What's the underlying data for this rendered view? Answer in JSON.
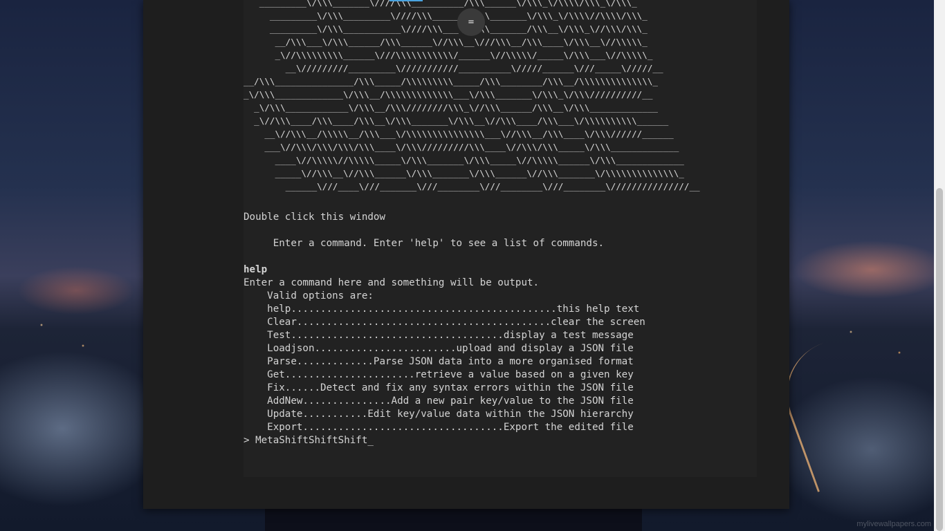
{
  "ascii_art": [
    "   _________\\/\\\\\\_______\\////\\\\\\__________/\\\\\\______\\/\\\\\\_\\/\\\\\\\\/\\\\\\_\\/\\\\\\_",
    "     _________\\/\\\\\\_________\\////\\\\\\_______/\\\\\\_______\\/\\\\\\_\\/\\\\\\\\//\\\\\\\\/\\\\\\_",
    "     _________\\/\\\\\\___________\\////\\\\\\___\\//\\\\\\_______/\\\\\\__\\/\\\\\\_\\//\\\\\\/\\\\\\_",
    "      __/\\\\\\___\\/\\\\\\______/\\\\\\______\\//\\\\\\__\\///\\\\\\__/\\\\\\____\\/\\\\\\__\\//\\\\\\\\\\_",
    "      _\\//\\\\\\\\\\\\\\\\\\______\\///\\\\\\\\\\\\\\\\\\\\\\/______\\//\\\\\\\\\\/_____\\/\\\\\\___\\//\\\\\\\\\\_",
    "        __\\/////////_________\\///////////__________\\/////______\\///_____\\/////__",
    "__/\\\\\\_______________/\\\\\\_____/\\\\\\\\\\\\\\\\\\_____/\\\\\\________/\\\\\\__/\\\\\\\\\\\\\\\\\\\\\\\\\\\\_",
    "_\\/\\\\\\_____________\\/\\\\\\__/\\\\\\\\\\\\\\\\\\\\\\\\\\___\\/\\\\\\_______\\/\\\\\\_\\/\\\\\\//////////__",
    "  _\\/\\\\\\____________\\/\\\\\\__/\\\\\\////////\\\\\\_\\//\\\\\\______/\\\\\\__\\/\\\\\\_____________",
    "  _\\//\\\\\\____/\\\\\\____/\\\\\\__\\/\\\\\\_______\\/\\\\\\__\\//\\\\\\____/\\\\\\___\\/\\\\\\\\\\\\\\\\\\\\______",
    "    __\\//\\\\\\__/\\\\\\\\\\__/\\\\\\___\\/\\\\\\\\\\\\\\\\\\\\\\\\\\\\\\___\\//\\\\\\__/\\\\\\____\\/\\\\\\//////______",
    "    ___\\//\\\\\\/\\\\\\/\\\\\\/\\\\\\____\\/\\\\\\/////////\\\\\\____\\//\\\\\\/\\\\\\_____\\/\\\\\\_____________",
    "      ____\\//\\\\\\\\\\//\\\\\\\\\\_____\\/\\\\\\_______\\/\\\\\\_____\\//\\\\\\\\\\______\\/\\\\\\_____________",
    "      _____\\//\\\\\\__\\//\\\\\\______\\/\\\\\\_______\\/\\\\\\______\\//\\\\\\_______\\/\\\\\\\\\\\\\\\\\\\\\\\\\\\\_",
    "        ______\\///____\\///_______\\///________\\///________\\///________\\///////////////__"
  ],
  "handle_glyph": "=",
  "terminal": {
    "double_click_hint": "Double click this window",
    "welcome": "     Enter a command. Enter 'help' to see a list of commands.",
    "entered_command": "help",
    "help_intro": "Enter a command here and something will be output.",
    "options_header": "    Valid options are:",
    "commands": [
      "    help.............................................this help text",
      "    Clear...........................................clear the screen",
      "    Test....................................display a test message",
      "    Loadjson........................upload and display a JSON file",
      "    Parse.............Parse JSON data into a more organised format",
      "    Get......................retrieve a value based on a given key",
      "    Fix......Detect and fix any syntax errors within the JSON file",
      "    AddNew...............Add a new pair key/value to the JSON file",
      "    Update...........Edit key/value data within the JSON hierarchy",
      "    Export..................................Export the edited file"
    ],
    "prompt_symbol": "> ",
    "current_input": "MetaShiftShiftShift",
    "cursor": "_"
  },
  "watermark": "mylivewallpapers.com",
  "colors": {
    "terminal_bg": "#222222",
    "window_bg": "#1e1e1e",
    "text": "#d4d4d4",
    "selection": "#4aa3df"
  }
}
